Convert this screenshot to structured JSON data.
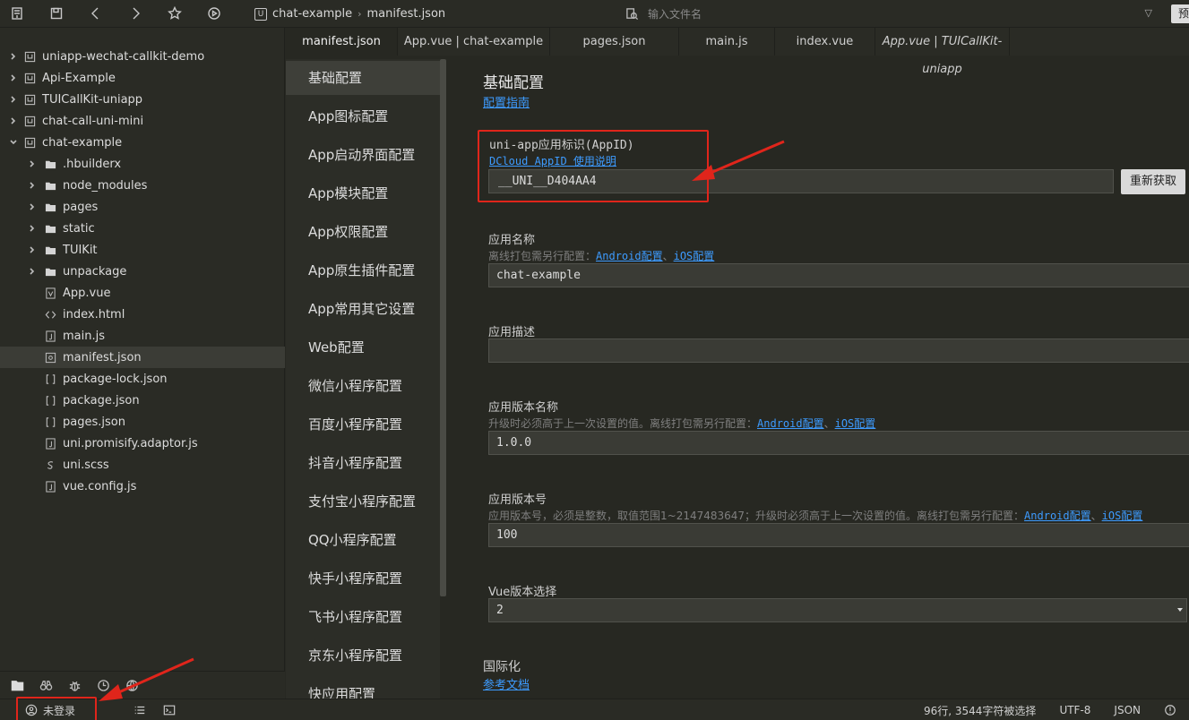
{
  "toolbar": {
    "breadcrumb_project": "chat-example",
    "breadcrumb_file": "manifest.json",
    "search_placeholder": "输入文件名",
    "preview_label": "预"
  },
  "sidebar": {
    "items": [
      {
        "label": "uniapp-wechat-callkit-demo",
        "type": "project",
        "expanded": false
      },
      {
        "label": "Api-Example",
        "type": "project",
        "expanded": false
      },
      {
        "label": "TUICallKit-uniapp",
        "type": "project",
        "expanded": false
      },
      {
        "label": "chat-call-uni-mini",
        "type": "project",
        "expanded": false
      },
      {
        "label": "chat-example",
        "type": "project",
        "expanded": true
      },
      {
        "label": ".hbuilderx",
        "type": "folder"
      },
      {
        "label": "node_modules",
        "type": "folder"
      },
      {
        "label": "pages",
        "type": "folder"
      },
      {
        "label": "static",
        "type": "folder"
      },
      {
        "label": "TUIKit",
        "type": "folder"
      },
      {
        "label": "unpackage",
        "type": "folder"
      },
      {
        "label": "App.vue",
        "type": "vue"
      },
      {
        "label": "index.html",
        "type": "html"
      },
      {
        "label": "main.js",
        "type": "js"
      },
      {
        "label": "manifest.json",
        "type": "manifest",
        "selected": true
      },
      {
        "label": "package-lock.json",
        "type": "json"
      },
      {
        "label": "package.json",
        "type": "json"
      },
      {
        "label": "pages.json",
        "type": "json"
      },
      {
        "label": "uni.promisify.adaptor.js",
        "type": "js"
      },
      {
        "label": "uni.scss",
        "type": "scss"
      },
      {
        "label": "vue.config.js",
        "type": "js"
      }
    ]
  },
  "tabs": [
    {
      "label": "manifest.json",
      "active": true
    },
    {
      "label": "App.vue | chat-example"
    },
    {
      "label": "pages.json"
    },
    {
      "label": "main.js"
    },
    {
      "label": "index.vue"
    },
    {
      "label": "App.vue | TUICallKit-uniapp",
      "italic": true
    }
  ],
  "config_nav": [
    {
      "label": "基础配置",
      "active": true
    },
    {
      "label": "App图标配置"
    },
    {
      "label": "App启动界面配置"
    },
    {
      "label": "App模块配置"
    },
    {
      "label": "App权限配置"
    },
    {
      "label": "App原生插件配置"
    },
    {
      "label": "App常用其它设置"
    },
    {
      "label": "Web配置"
    },
    {
      "label": "微信小程序配置"
    },
    {
      "label": "百度小程序配置"
    },
    {
      "label": "抖音小程序配置"
    },
    {
      "label": "支付宝小程序配置"
    },
    {
      "label": "QQ小程序配置"
    },
    {
      "label": "快手小程序配置"
    },
    {
      "label": "飞书小程序配置"
    },
    {
      "label": "京东小程序配置"
    },
    {
      "label": "快应用配置"
    }
  ],
  "form": {
    "title": "基础配置",
    "guide_link": "配置指南",
    "appid": {
      "label": "uni-app应用标识(AppID)",
      "help_link": "DCloud AppID 使用说明",
      "value": "__UNI__D404AA4",
      "refresh_button": "重新获取"
    },
    "app_name": {
      "label": "应用名称",
      "hint": "离线打包需另行配置：",
      "android_link": "Android配置",
      "sep": "、",
      "ios_link": "iOS配置",
      "value": "chat-example"
    },
    "app_desc": {
      "label": "应用描述",
      "value": ""
    },
    "version_name": {
      "label": "应用版本名称",
      "hint": "升级时必须高于上一次设置的值。离线打包需另行配置：",
      "android_link": "Android配置",
      "sep": "、",
      "ios_link": "iOS配置",
      "value": "1.0.0"
    },
    "version_code": {
      "label": "应用版本号",
      "hint": "应用版本号，必须是整数，取值范围1~2147483647；升级时必须高于上一次设置的值。离线打包需另行配置：",
      "android_link": "Android配置",
      "sep": "、",
      "ios_link": "iOS配置",
      "value": "100"
    },
    "vue_version": {
      "label": "Vue版本选择",
      "value": "2"
    },
    "i18n": {
      "label": "国际化",
      "link": "参考文档"
    }
  },
  "statusbar": {
    "login": "未登录",
    "position": "96行, 3544字符被选择",
    "encoding": "UTF-8",
    "language": "JSON"
  },
  "colors": {
    "highlight_red": "#e0251b",
    "link_blue": "#3d9bff"
  }
}
